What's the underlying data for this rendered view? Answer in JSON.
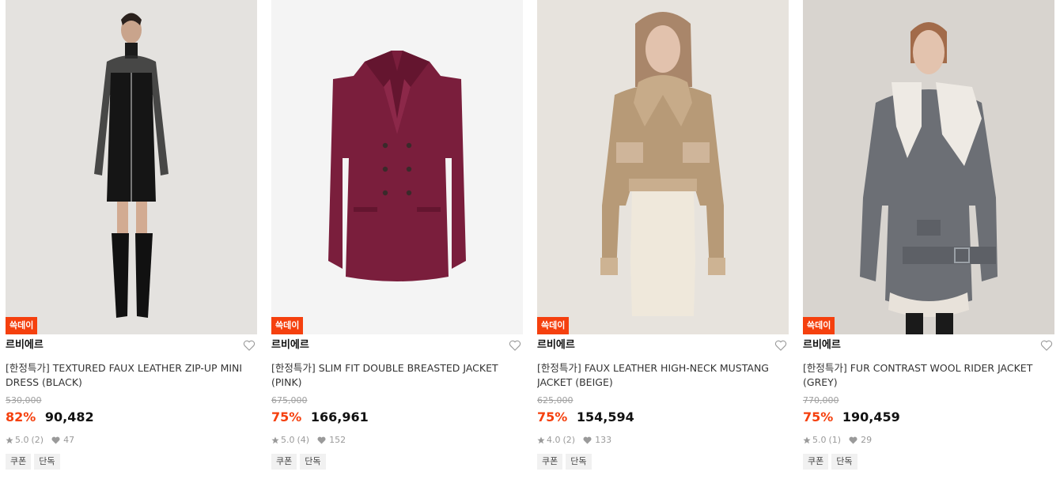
{
  "products": [
    {
      "badge": "쓱데이",
      "brand": "르비에르",
      "name": "[한정특가] TEXTURED FAUX LEATHER ZIP-UP MINI DRESS (BLACK)",
      "original_price": "530,000",
      "discount": "82%",
      "price": "90,482",
      "rating": "5.0",
      "review_count": "(2)",
      "likes": "47",
      "tags": [
        "쿠폰",
        "단독"
      ],
      "bg_color": "#e3e1de"
    },
    {
      "badge": "쓱데이",
      "brand": "르비에르",
      "name": "[한정특가] SLIM FIT DOUBLE BREASTED JACKET (PINK)",
      "original_price": "675,000",
      "discount": "75%",
      "price": "166,961",
      "rating": "5.0",
      "review_count": "(4)",
      "likes": "152",
      "tags": [
        "쿠폰",
        "단독"
      ],
      "bg_color": "#f4f4f4"
    },
    {
      "badge": "쓱데이",
      "brand": "르비에르",
      "name": "[한정특가] FAUX LEATHER HIGH-NECK MUSTANG JACKET (BEIGE)",
      "original_price": "625,000",
      "discount": "75%",
      "price": "154,594",
      "rating": "4.0",
      "review_count": "(2)",
      "likes": "133",
      "tags": [
        "쿠폰",
        "단독"
      ],
      "bg_color": "#e6e2dc"
    },
    {
      "badge": "쓱데이",
      "brand": "르비에르",
      "name": "[한정특가] FUR CONTRAST WOOL RIDER JACKET (GREY)",
      "original_price": "770,000",
      "discount": "75%",
      "price": "190,459",
      "rating": "5.0",
      "review_count": "(1)",
      "likes": "29",
      "tags": [
        "쿠폰",
        "단독"
      ],
      "bg_color": "#dcd8d3"
    }
  ],
  "colors": {
    "accent": "#f5400e",
    "strike": "#a0a0a0",
    "tag_bg": "#f1f1f1"
  }
}
